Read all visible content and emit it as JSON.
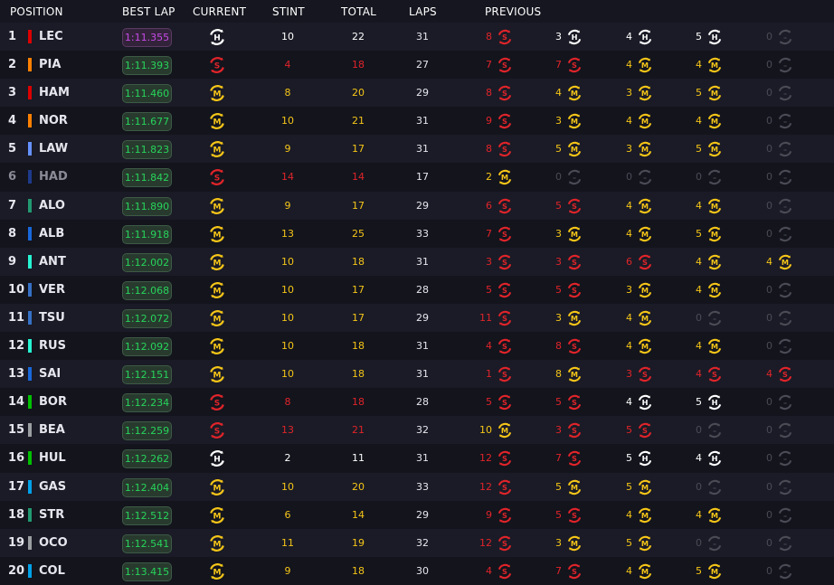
{
  "headers": {
    "position": "POSITION",
    "best_lap": "BEST LAP",
    "current": "CURRENT",
    "stint": "STINT",
    "total": "TOTAL",
    "laps": "LAPS",
    "previous": "PREVIOUS"
  },
  "colors": {
    "soft": "#e0242a",
    "medium": "#f5c518",
    "hard": "#ffffff",
    "none": "#4a4b55",
    "lap_green": "#27d35b",
    "lap_purple": "#c74ae8",
    "stint_soft": "#e0242a",
    "stint_medium": "#f5c518",
    "stint_hard": "#ffffff"
  },
  "rows": [
    {
      "pos": "1",
      "driver": "LEC",
      "team_color": "#dc0000",
      "best_lap": "1:11.355",
      "lap_class": "purple",
      "current": "H",
      "stint": "10",
      "total": "22",
      "laps": "31",
      "previous": [
        {
          "n": "8",
          "t": "S"
        },
        {
          "n": "3",
          "t": "H"
        },
        {
          "n": "4",
          "t": "H"
        },
        {
          "n": "5",
          "t": "H"
        },
        {
          "n": "0",
          "t": "-"
        }
      ]
    },
    {
      "pos": "2",
      "driver": "PIA",
      "team_color": "#ff8000",
      "best_lap": "1:11.393",
      "lap_class": "green",
      "current": "S",
      "stint": "4",
      "total": "18",
      "laps": "27",
      "previous": [
        {
          "n": "7",
          "t": "S"
        },
        {
          "n": "7",
          "t": "S"
        },
        {
          "n": "4",
          "t": "M"
        },
        {
          "n": "4",
          "t": "M"
        },
        {
          "n": "0",
          "t": "-"
        }
      ]
    },
    {
      "pos": "3",
      "driver": "HAM",
      "team_color": "#dc0000",
      "best_lap": "1:11.460",
      "lap_class": "green",
      "current": "M",
      "stint": "8",
      "total": "20",
      "laps": "29",
      "previous": [
        {
          "n": "8",
          "t": "S"
        },
        {
          "n": "4",
          "t": "M"
        },
        {
          "n": "3",
          "t": "M"
        },
        {
          "n": "5",
          "t": "M"
        },
        {
          "n": "0",
          "t": "-"
        }
      ]
    },
    {
      "pos": "4",
      "driver": "NOR",
      "team_color": "#ff8000",
      "best_lap": "1:11.677",
      "lap_class": "green",
      "current": "M",
      "stint": "10",
      "total": "21",
      "laps": "31",
      "previous": [
        {
          "n": "9",
          "t": "S"
        },
        {
          "n": "3",
          "t": "M"
        },
        {
          "n": "4",
          "t": "M"
        },
        {
          "n": "4",
          "t": "M"
        },
        {
          "n": "0",
          "t": "-"
        }
      ]
    },
    {
      "pos": "5",
      "driver": "LAW",
      "team_color": "#6692ff",
      "best_lap": "1:11.823",
      "lap_class": "green",
      "current": "M",
      "stint": "9",
      "total": "17",
      "laps": "31",
      "previous": [
        {
          "n": "8",
          "t": "S"
        },
        {
          "n": "5",
          "t": "M"
        },
        {
          "n": "3",
          "t": "M"
        },
        {
          "n": "5",
          "t": "M"
        },
        {
          "n": "0",
          "t": "-"
        }
      ]
    },
    {
      "pos": "6",
      "driver": "HAD",
      "team_color": "#1e3a8a",
      "best_lap": "1:11.842",
      "lap_class": "green",
      "current": "S",
      "stint": "14",
      "total": "14",
      "laps": "17",
      "retired": true,
      "previous": [
        {
          "n": "2",
          "t": "M"
        },
        {
          "n": "0",
          "t": "-"
        },
        {
          "n": "0",
          "t": "-"
        },
        {
          "n": "0",
          "t": "-"
        },
        {
          "n": "0",
          "t": "-"
        }
      ]
    },
    {
      "pos": "7",
      "driver": "ALO",
      "team_color": "#229971",
      "best_lap": "1:11.890",
      "lap_class": "green",
      "current": "M",
      "stint": "9",
      "total": "17",
      "laps": "29",
      "previous": [
        {
          "n": "6",
          "t": "S"
        },
        {
          "n": "5",
          "t": "S"
        },
        {
          "n": "4",
          "t": "M"
        },
        {
          "n": "4",
          "t": "M"
        },
        {
          "n": "0",
          "t": "-"
        }
      ]
    },
    {
      "pos": "8",
      "driver": "ALB",
      "team_color": "#1868db",
      "best_lap": "1:11.918",
      "lap_class": "green",
      "current": "M",
      "stint": "13",
      "total": "25",
      "laps": "33",
      "previous": [
        {
          "n": "7",
          "t": "S"
        },
        {
          "n": "3",
          "t": "M"
        },
        {
          "n": "4",
          "t": "M"
        },
        {
          "n": "5",
          "t": "M"
        },
        {
          "n": "0",
          "t": "-"
        }
      ]
    },
    {
      "pos": "9",
      "driver": "ANT",
      "team_color": "#27f4d2",
      "best_lap": "1:12.002",
      "lap_class": "green",
      "current": "M",
      "stint": "10",
      "total": "18",
      "laps": "31",
      "previous": [
        {
          "n": "3",
          "t": "S"
        },
        {
          "n": "3",
          "t": "S"
        },
        {
          "n": "6",
          "t": "S"
        },
        {
          "n": "4",
          "t": "M"
        },
        {
          "n": "4",
          "t": "M"
        }
      ]
    },
    {
      "pos": "10",
      "driver": "VER",
      "team_color": "#3671c6",
      "best_lap": "1:12.068",
      "lap_class": "green",
      "current": "M",
      "stint": "10",
      "total": "17",
      "laps": "28",
      "previous": [
        {
          "n": "5",
          "t": "S"
        },
        {
          "n": "5",
          "t": "S"
        },
        {
          "n": "3",
          "t": "M"
        },
        {
          "n": "4",
          "t": "M"
        },
        {
          "n": "0",
          "t": "-"
        }
      ]
    },
    {
      "pos": "11",
      "driver": "TSU",
      "team_color": "#3671c6",
      "best_lap": "1:12.072",
      "lap_class": "green",
      "current": "M",
      "stint": "10",
      "total": "17",
      "laps": "29",
      "previous": [
        {
          "n": "11",
          "t": "S"
        },
        {
          "n": "3",
          "t": "M"
        },
        {
          "n": "4",
          "t": "M"
        },
        {
          "n": "0",
          "t": "-"
        },
        {
          "n": "0",
          "t": "-"
        }
      ]
    },
    {
      "pos": "12",
      "driver": "RUS",
      "team_color": "#27f4d2",
      "best_lap": "1:12.092",
      "lap_class": "green",
      "current": "M",
      "stint": "10",
      "total": "18",
      "laps": "31",
      "previous": [
        {
          "n": "4",
          "t": "S"
        },
        {
          "n": "8",
          "t": "S"
        },
        {
          "n": "4",
          "t": "M"
        },
        {
          "n": "4",
          "t": "M"
        },
        {
          "n": "0",
          "t": "-"
        }
      ]
    },
    {
      "pos": "13",
      "driver": "SAI",
      "team_color": "#1868db",
      "best_lap": "1:12.151",
      "lap_class": "green",
      "current": "M",
      "stint": "10",
      "total": "18",
      "laps": "31",
      "previous": [
        {
          "n": "1",
          "t": "S"
        },
        {
          "n": "8",
          "t": "M"
        },
        {
          "n": "3",
          "t": "S"
        },
        {
          "n": "4",
          "t": "S"
        },
        {
          "n": "4",
          "t": "S"
        }
      ]
    },
    {
      "pos": "14",
      "driver": "BOR",
      "team_color": "#00c000",
      "best_lap": "1:12.234",
      "lap_class": "green",
      "current": "S",
      "stint": "8",
      "total": "18",
      "laps": "28",
      "previous": [
        {
          "n": "5",
          "t": "S"
        },
        {
          "n": "5",
          "t": "S"
        },
        {
          "n": "4",
          "t": "H"
        },
        {
          "n": "5",
          "t": "H"
        },
        {
          "n": "0",
          "t": "-"
        }
      ]
    },
    {
      "pos": "15",
      "driver": "BEA",
      "team_color": "#9c9fa2",
      "best_lap": "1:12.259",
      "lap_class": "green",
      "current": "S",
      "stint": "13",
      "total": "21",
      "laps": "32",
      "previous": [
        {
          "n": "10",
          "t": "M"
        },
        {
          "n": "3",
          "t": "S"
        },
        {
          "n": "5",
          "t": "S"
        },
        {
          "n": "0",
          "t": "-"
        },
        {
          "n": "0",
          "t": "-"
        }
      ]
    },
    {
      "pos": "16",
      "driver": "HUL",
      "team_color": "#00c000",
      "best_lap": "1:12.262",
      "lap_class": "green",
      "current": "H",
      "stint": "2",
      "total": "11",
      "laps": "31",
      "previous": [
        {
          "n": "12",
          "t": "S"
        },
        {
          "n": "7",
          "t": "S"
        },
        {
          "n": "5",
          "t": "H"
        },
        {
          "n": "4",
          "t": "H"
        },
        {
          "n": "0",
          "t": "-"
        }
      ]
    },
    {
      "pos": "17",
      "driver": "GAS",
      "team_color": "#00a1e8",
      "best_lap": "1:12.404",
      "lap_class": "green",
      "current": "M",
      "stint": "10",
      "total": "20",
      "laps": "33",
      "previous": [
        {
          "n": "12",
          "t": "S"
        },
        {
          "n": "5",
          "t": "M"
        },
        {
          "n": "5",
          "t": "M"
        },
        {
          "n": "0",
          "t": "-"
        },
        {
          "n": "0",
          "t": "-"
        }
      ]
    },
    {
      "pos": "18",
      "driver": "STR",
      "team_color": "#229971",
      "best_lap": "1:12.512",
      "lap_class": "green",
      "current": "M",
      "stint": "6",
      "total": "14",
      "laps": "29",
      "previous": [
        {
          "n": "9",
          "t": "S"
        },
        {
          "n": "5",
          "t": "S"
        },
        {
          "n": "4",
          "t": "M"
        },
        {
          "n": "4",
          "t": "M"
        },
        {
          "n": "0",
          "t": "-"
        }
      ]
    },
    {
      "pos": "19",
      "driver": "OCO",
      "team_color": "#9c9fa2",
      "best_lap": "1:12.541",
      "lap_class": "green",
      "current": "M",
      "stint": "11",
      "total": "19",
      "laps": "32",
      "previous": [
        {
          "n": "12",
          "t": "S"
        },
        {
          "n": "3",
          "t": "M"
        },
        {
          "n": "5",
          "t": "M"
        },
        {
          "n": "0",
          "t": "-"
        },
        {
          "n": "0",
          "t": "-"
        }
      ]
    },
    {
      "pos": "20",
      "driver": "COL",
      "team_color": "#00a1e8",
      "best_lap": "1:13.415",
      "lap_class": "green",
      "current": "M",
      "stint": "9",
      "total": "18",
      "laps": "30",
      "previous": [
        {
          "n": "4",
          "t": "S"
        },
        {
          "n": "7",
          "t": "S"
        },
        {
          "n": "4",
          "t": "M"
        },
        {
          "n": "5",
          "t": "M"
        },
        {
          "n": "0",
          "t": "-"
        }
      ]
    }
  ]
}
